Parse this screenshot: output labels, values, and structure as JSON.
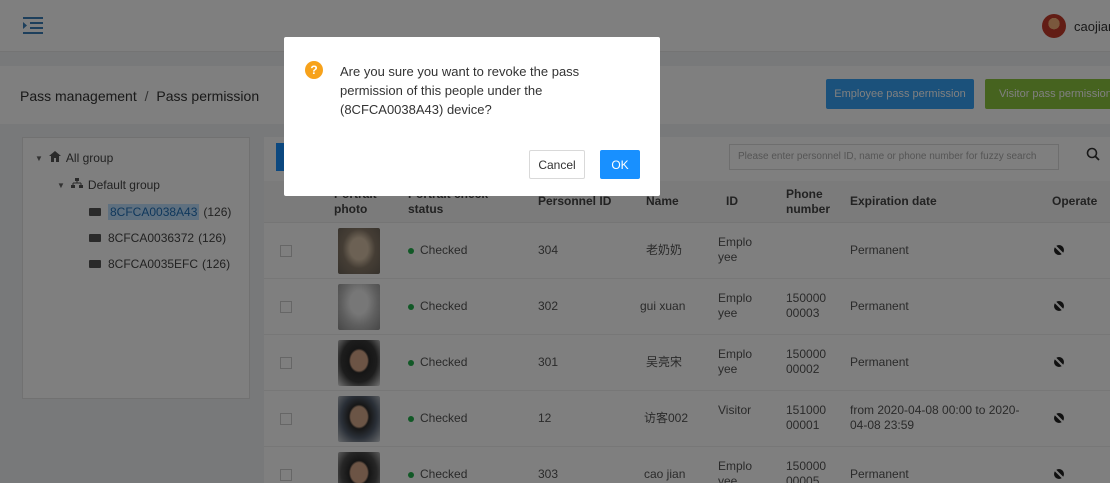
{
  "header": {
    "menu_icon": "menu-fold-icon",
    "username": "caojian"
  },
  "breadcrumb": {
    "section": "Pass management",
    "separator": "/",
    "page": "Pass permission"
  },
  "actions": {
    "employee_label": "Employee pass permission",
    "visitor_label": "Visitor pass permission"
  },
  "tree": {
    "root": "All group",
    "group": "Default group",
    "devices": [
      "8CFCA0038A43",
      "8CFCA0036372",
      "8CFCA0035EFC"
    ],
    "counts": [
      "(126)",
      "(126)",
      "(126)"
    ]
  },
  "search": {
    "placeholder": "Please enter personnel ID, name or phone number for fuzzy search"
  },
  "table": {
    "headers": {
      "photo": "Portrait photo",
      "status": "Portrait check status",
      "pid": "Personnel ID",
      "name": "Name",
      "id": "ID",
      "phone": "Phone number",
      "exp": "Expiration date",
      "op": "Operate"
    },
    "rows": [
      {
        "status": "Checked",
        "pid": "304",
        "name": "老奶奶",
        "type": "Employee",
        "phone": "",
        "exp": "Permanent"
      },
      {
        "status": "Checked",
        "pid": "302",
        "name": "gui xuan",
        "type": "Employee",
        "phone": "15000000003",
        "exp": "Permanent"
      },
      {
        "status": "Checked",
        "pid": "301",
        "name": "吴亮宋",
        "type": "Employee",
        "phone": "15000000002",
        "exp": "Permanent"
      },
      {
        "status": "Checked",
        "pid": "12",
        "name": "访客002",
        "type": "Visitor",
        "phone": "15100000001",
        "exp": "from 2020-04-08 00:00 to 2020-04-08 23:59"
      },
      {
        "status": "Checked",
        "pid": "303",
        "name": "cao jian",
        "type": "Employee",
        "phone": "15000000005",
        "exp": "Permanent"
      }
    ]
  },
  "dialog": {
    "message": "Are you sure you want to revoke the pass permission of this people under the (8CFCA0038A43) device?",
    "cancel": "Cancel",
    "ok": "OK"
  },
  "colors": {
    "primary": "#1890ff",
    "visitor_button": "#8cc63f",
    "checked_dot": "#22b14c",
    "warning_icon": "#f7a21b"
  }
}
